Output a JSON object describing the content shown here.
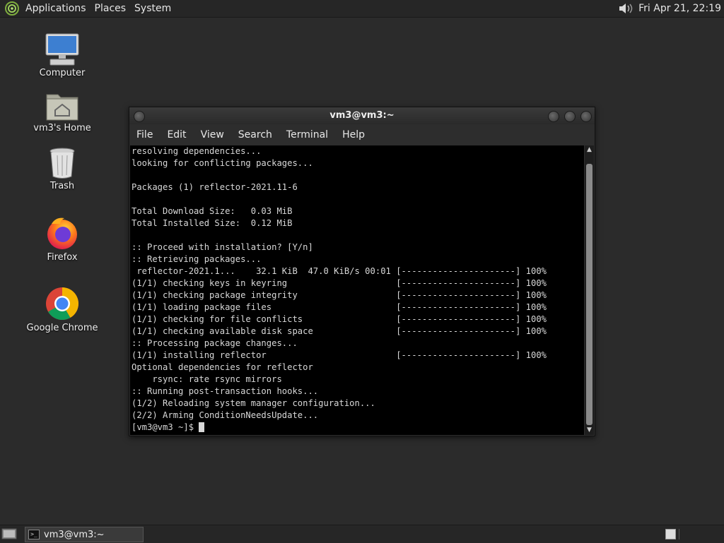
{
  "top_panel": {
    "menus": [
      "Applications",
      "Places",
      "System"
    ],
    "clock": "Fri Apr 21, 22:19"
  },
  "desktop_icons": [
    {
      "label": "Computer",
      "icon": "computer-icon"
    },
    {
      "label": "vm3's Home",
      "icon": "home-folder-icon"
    },
    {
      "label": "Trash",
      "icon": "trash-icon"
    },
    {
      "label": "Firefox",
      "icon": "firefox-icon"
    },
    {
      "label": "Google Chrome",
      "icon": "chrome-icon"
    }
  ],
  "terminal": {
    "title": "vm3@vm3:~",
    "menu": [
      "File",
      "Edit",
      "View",
      "Search",
      "Terminal",
      "Help"
    ],
    "lines": [
      "resolving dependencies...",
      "looking for conflicting packages...",
      "",
      "Packages (1) reflector-2021.11-6",
      "",
      "Total Download Size:   0.03 MiB",
      "Total Installed Size:  0.12 MiB",
      "",
      ":: Proceed with installation? [Y/n]",
      ":: Retrieving packages...",
      " reflector-2021.1...    32.1 KiB  47.0 KiB/s 00:01 [----------------------] 100%",
      "(1/1) checking keys in keyring                     [----------------------] 100%",
      "(1/1) checking package integrity                   [----------------------] 100%",
      "(1/1) loading package files                        [----------------------] 100%",
      "(1/1) checking for file conflicts                  [----------------------] 100%",
      "(1/1) checking available disk space                [----------------------] 100%",
      ":: Processing package changes...",
      "(1/1) installing reflector                         [----------------------] 100%",
      "Optional dependencies for reflector",
      "    rsync: rate rsync mirrors",
      ":: Running post-transaction hooks...",
      "(1/2) Reloading system manager configuration...",
      "(2/2) Arming ConditionNeedsUpdate...",
      "[vm3@vm3 ~]$ "
    ]
  },
  "taskbar": {
    "window_button": "vm3@vm3:~"
  },
  "colors": {
    "desktop_bg": "#2b2b2b",
    "panel_bg": "#262626",
    "terminal_bg": "#000000",
    "terminal_fg": "#d8d8d8"
  }
}
